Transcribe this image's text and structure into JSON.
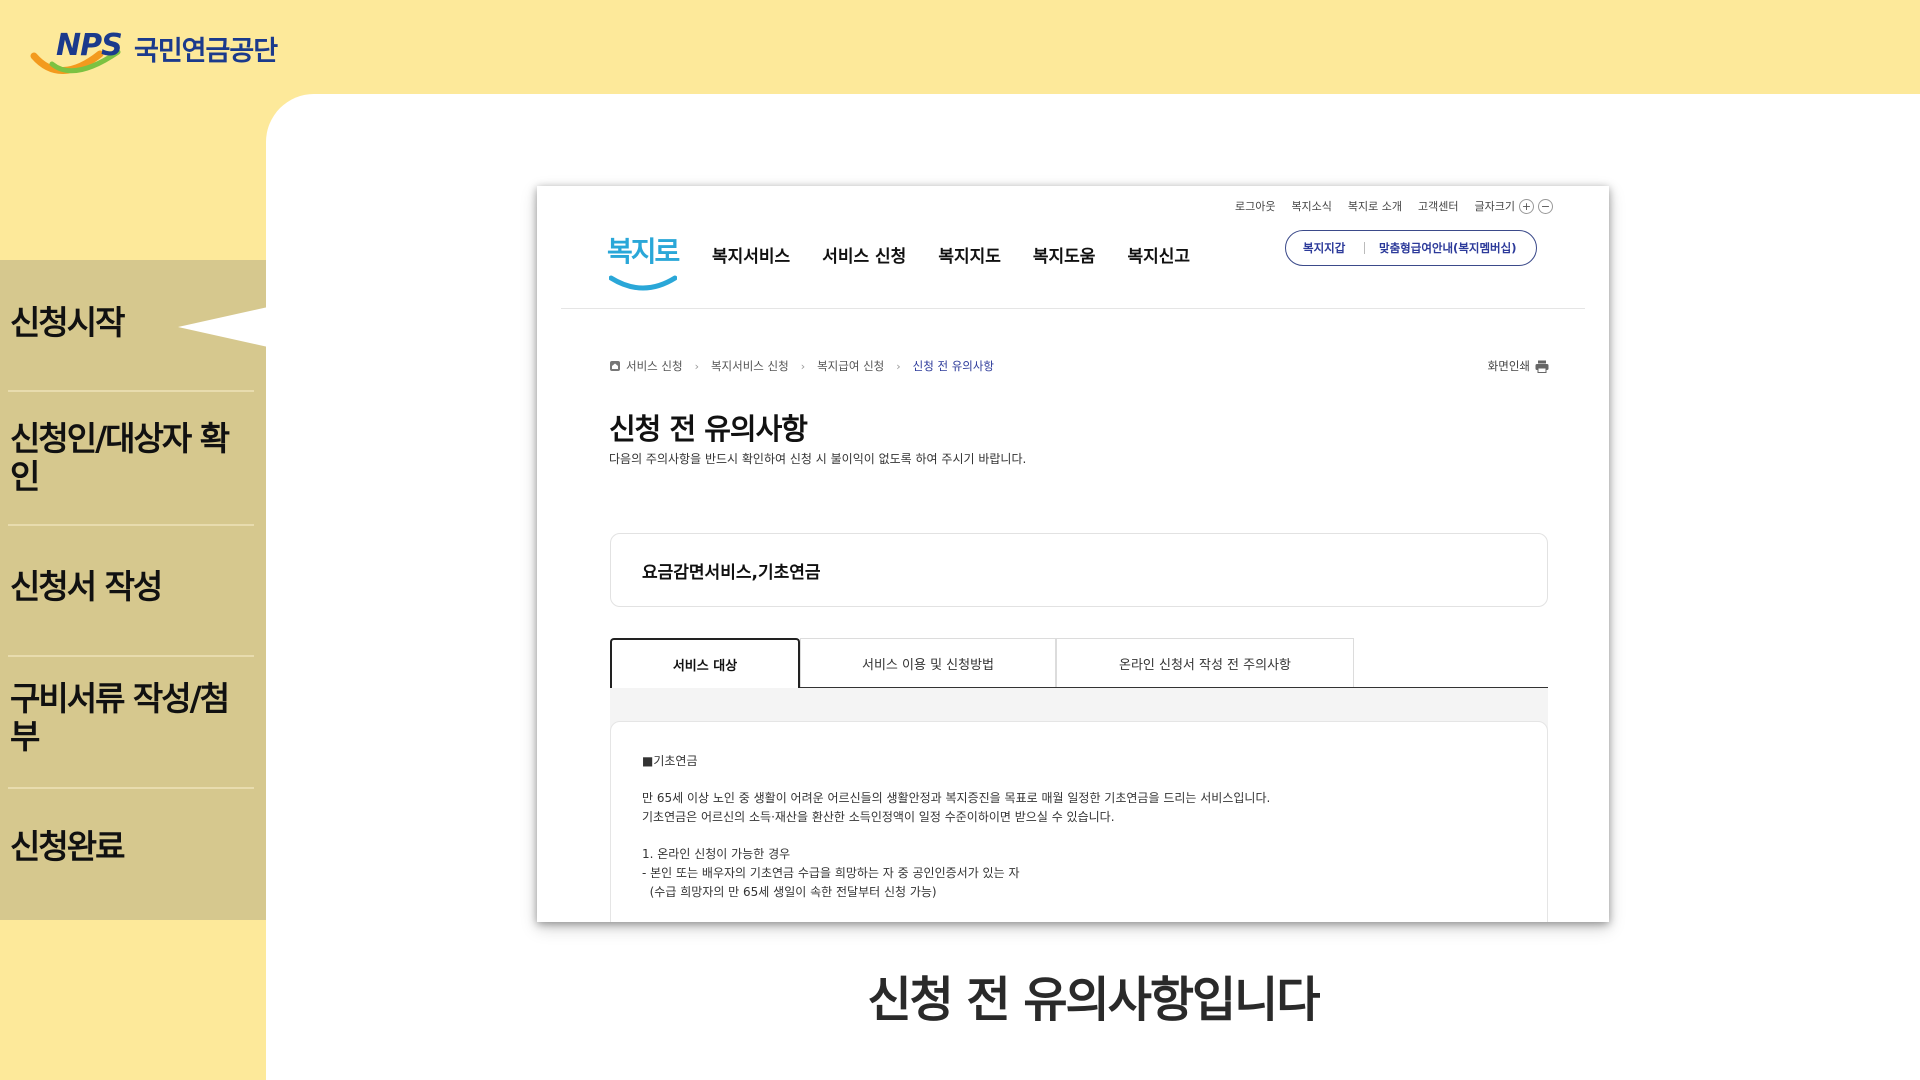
{
  "brand": {
    "nps_mark": "NPS",
    "org_name": "국민연금공단"
  },
  "steps": [
    {
      "label": "신청시작",
      "active": true
    },
    {
      "label": "신청인/대상자 확인",
      "active": false
    },
    {
      "label": "신청서 작성",
      "active": false
    },
    {
      "label": "구비서류 작성/첨부",
      "active": false
    },
    {
      "label": "신청완료",
      "active": false
    }
  ],
  "caption": "신청 전 유의사항입니다",
  "site": {
    "logo_text": "복지로",
    "util_nav": [
      "로그아웃",
      "복지소식",
      "복지로 소개",
      "고객센터",
      "글자크기"
    ],
    "font_size_buttons": [
      "+",
      "−"
    ],
    "gnb": [
      "복지서비스",
      "서비스 신청",
      "복지지도",
      "복지도움",
      "복지신고"
    ],
    "pill_links": [
      "복지지갑",
      "맞춤형급여안내(복지멤버십)"
    ],
    "breadcrumb": [
      "서비스 신청",
      "복지서비스 신청",
      "복지급여 신청",
      "신청 전 유의사항"
    ],
    "print_label": "화면인쇄",
    "page_title": "신청 전 유의사항",
    "page_subtitle": "다음의 주의사항을 반드시 확인하여 신청 시 불이익이 없도록 하여 주시기 바랍니다.",
    "service_name": "요금감면서비스,기초연금",
    "tabs": [
      "서비스 대상",
      "서비스 이용 및 신청방법",
      "온라인 신청서 작성 전 주의사항"
    ],
    "active_tab": 0,
    "panel": {
      "heading": "■기초연금",
      "para1_line1": "만 65세 이상 노인 중 생활이 어려운 어르신들의 생활안정과 복지증진을 목표로 매월 일정한 기초연금을 드리는 서비스입니다.",
      "para1_line2": "기초연금은 어르신의 소득·재산을 환산한 소득인정액이 일정 수준이하이면 받으실 수 있습니다.",
      "item1_title": "1. 온라인 신청이 가능한 경우",
      "item1_line1": "- 본인 또는 배우자의 기초연금 수급을 희망하는 자 중 공인인증서가 있는 자",
      "item1_line2": "  (수급 희망자의 만 65세 생일이 속한 전달부터 신청 가능)"
    }
  },
  "colors": {
    "background": "#fde99a",
    "sidebar": "#d6c88e",
    "brand_navy": "#1b3a8c",
    "link_blue": "#2c3a9a",
    "site_logo_blue": "#2aa7d8"
  }
}
